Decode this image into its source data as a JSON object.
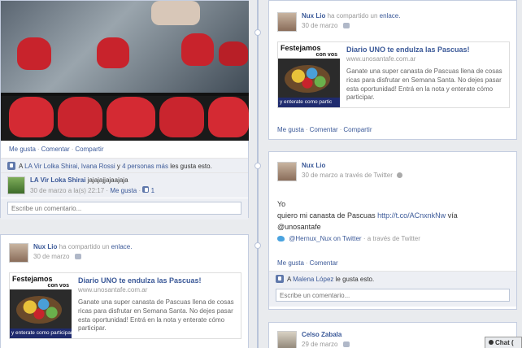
{
  "colors": {
    "link": "#3b5998",
    "background": "#e9ebee",
    "muted": "#999999"
  },
  "photo_post": {
    "actions": [
      "Me gusta",
      "Comentar",
      "Compartir"
    ],
    "likes": {
      "prefix": "A",
      "names": "LA Vir Lolka Shirai, Ivana Rossi",
      "and": "y",
      "others": "4 personas más",
      "suffix": "les gusta esto."
    },
    "comment": {
      "author": "LA Vir Loka Shirai",
      "text": "jajajajjajaajaja",
      "time": "30 de marzo a la(s) 22:17",
      "like_label": "Me gusta",
      "like_count": "1"
    },
    "comment_placeholder": "Escribe un comentario..."
  },
  "left_share_post": {
    "author": "Nux Lio",
    "verb": "ha compartido un",
    "object": "enlace.",
    "date": "30 de marzo",
    "thumb_top": "Festejamos",
    "thumb_sub": "con vos",
    "thumb_bottom": "y enterate como participar",
    "link_title": "Diario UNO te endulza las Pascuas!",
    "link_url": "www.unosantafe.com.ar",
    "link_desc": "Ganate una super canasta de Pascuas llena de cosas ricas para disfrutar en Semana Santa. No dejes pasar esta oportunidad! Entrá en la nota y enterate cómo participar."
  },
  "right_share_post": {
    "author": "Nux Lio",
    "verb": "ha compartido un",
    "object": "enlace.",
    "date": "30 de marzo",
    "thumb_top": "Festejamos",
    "thumb_sub": "con vos",
    "thumb_bottom": "y enterate como partic",
    "link_title": "Diario UNO te endulza las Pascuas!",
    "link_url": "www.unosantafe.com.ar",
    "link_desc": "Ganate una super canasta de Pascuas llena de cosas ricas para disfrutar en Semana Santa. No dejes pasar esta oportunidad! Entrá en la nota y enterate cómo participar.",
    "actions": [
      "Me gusta",
      "Comentar",
      "Compartir"
    ]
  },
  "twitter_post": {
    "author": "Nux Lio",
    "meta": "30 de marzo a través de Twitter",
    "line1": "Yo",
    "line2_text": "quiero mi canasta de Pascuas",
    "line2_link": "http://t.co/ACnxnkNw",
    "line2_end": "vía",
    "line3": "@unosantafe",
    "source_handle": "@Hernux_Nux on Twitter",
    "source_via": "· a través de Twitter",
    "actions": [
      "Me gusta",
      "Comentar"
    ],
    "likes": {
      "prefix": "A",
      "name": "Malena López",
      "suffix": "le gusta esto."
    },
    "comment_placeholder": "Escribe un comentario..."
  },
  "bottom_post": {
    "author": "Celso Zabala",
    "date": "29 de marzo"
  },
  "chat": {
    "label": "Chat ("
  },
  "icons": [
    "people-icon",
    "gear-icon",
    "twitter-bird-icon",
    "thumbs-up-icon"
  ]
}
